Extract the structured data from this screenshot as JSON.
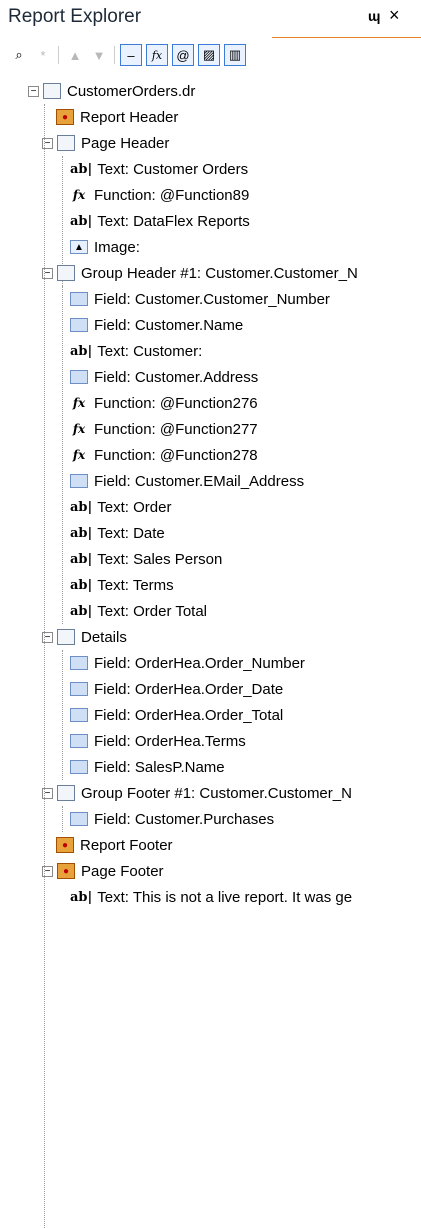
{
  "panel": {
    "title": "Report Explorer",
    "pin_glyph": "ɰ",
    "close_glyph": "×"
  },
  "toolbar": {
    "buttons": [
      {
        "name": "find-icon",
        "glyph": "⌕"
      },
      {
        "name": "find-next-icon",
        "glyph": "*"
      },
      {
        "name": "up-arrow-icon",
        "glyph": "▲"
      },
      {
        "name": "down-arrow-icon",
        "glyph": "▼"
      },
      {
        "name": "line-icon",
        "glyph": "–"
      },
      {
        "name": "function-icon",
        "glyph": "fx"
      },
      {
        "name": "at-icon",
        "glyph": "@"
      },
      {
        "name": "image-icon",
        "glyph": "▨"
      },
      {
        "name": "panel-icon",
        "glyph": "▥"
      }
    ]
  },
  "tree": {
    "root": "CustomerOrders.dr",
    "items": [
      {
        "label": "Report Header"
      },
      {
        "label": "Page Header"
      },
      {
        "label": "Text: Customer Orders"
      },
      {
        "label": "Function: @Function89"
      },
      {
        "label": "Text: DataFlex Reports"
      },
      {
        "label": "Image:"
      },
      {
        "label": "Group Header #1: Customer.Customer_N"
      },
      {
        "label": "Field: Customer.Customer_Number"
      },
      {
        "label": "Field: Customer.Name"
      },
      {
        "label": "Text: Customer:"
      },
      {
        "label": "Field: Customer.Address"
      },
      {
        "label": "Function: @Function276"
      },
      {
        "label": "Function: @Function277"
      },
      {
        "label": "Function: @Function278"
      },
      {
        "label": "Field: Customer.EMail_Address"
      },
      {
        "label": "Text: Order"
      },
      {
        "label": "Text: Date"
      },
      {
        "label": "Text: Sales Person"
      },
      {
        "label": "Text: Terms"
      },
      {
        "label": "Text: Order Total"
      },
      {
        "label": "Details"
      },
      {
        "label": "Field: OrderHea.Order_Number"
      },
      {
        "label": "Field: OrderHea.Order_Date"
      },
      {
        "label": "Field: OrderHea.Order_Total"
      },
      {
        "label": "Field: OrderHea.Terms"
      },
      {
        "label": "Field: SalesP.Name"
      },
      {
        "label": "Group Footer #1: Customer.Customer_N"
      },
      {
        "label": "Field: Customer.Purchases"
      },
      {
        "label": "Report Footer"
      },
      {
        "label": "Page Footer"
      },
      {
        "label": "Text: This is not a live report. It was ge"
      }
    ]
  },
  "icons": {
    "text_glyph": "ab|",
    "function_glyph": "fx",
    "expander_minus": "−"
  }
}
